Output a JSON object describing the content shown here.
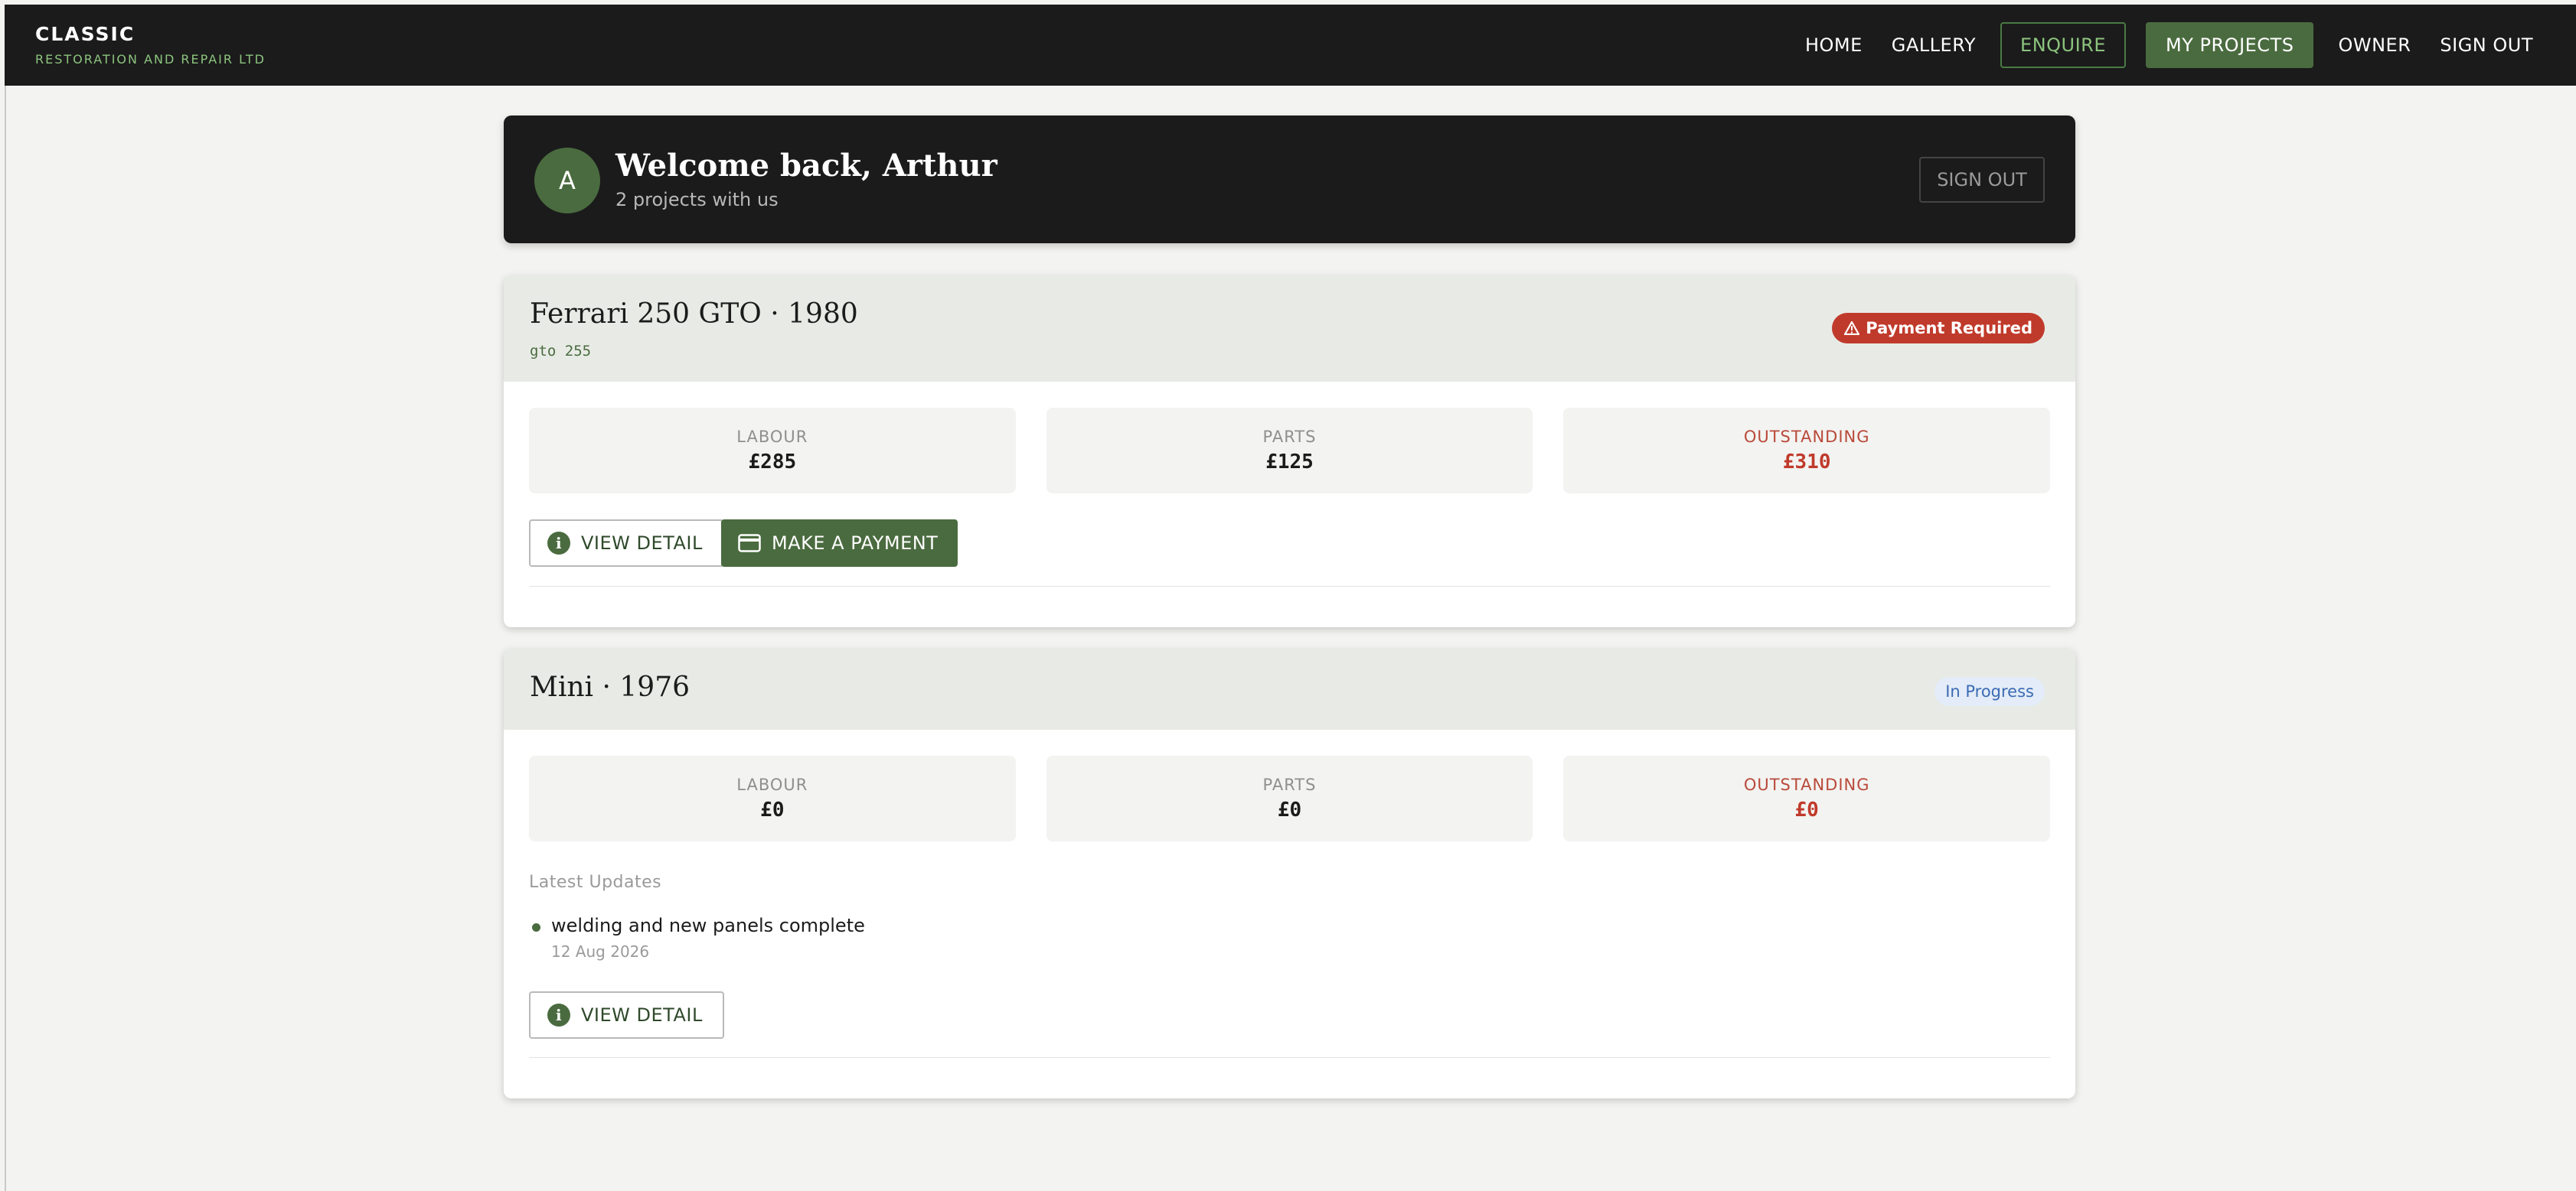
{
  "brand": {
    "name": "CLASSIC",
    "subtitle": "RESTORATION AND REPAIR LTD"
  },
  "nav": {
    "home": "HOME",
    "gallery": "GALLERY",
    "enquire": "ENQUIRE",
    "my_projects": "MY PROJECTS",
    "owner": "OWNER",
    "sign_out": "SIGN OUT"
  },
  "welcome": {
    "avatar_initial": "A",
    "title": "Welcome back, Arthur",
    "subtitle": "2 projects with us",
    "sign_out": "SIGN OUT"
  },
  "projects": [
    {
      "title": "Ferrari 250 GTO · 1980",
      "registration": "gto 255",
      "status": "Payment Required",
      "status_icon": "warning-icon",
      "stats": [
        {
          "label": "LABOUR",
          "value": "£285"
        },
        {
          "label": "PARTS",
          "value": "£125"
        },
        {
          "label": "OUTSTANDING",
          "value": "£310"
        }
      ],
      "view_detail": "VIEW DETAIL",
      "make_payment": "MAKE A PAYMENT"
    },
    {
      "title": "Mini · 1976",
      "status": "In Progress",
      "stats": [
        {
          "label": "LABOUR",
          "value": "£0"
        },
        {
          "label": "PARTS",
          "value": "£0"
        },
        {
          "label": "OUTSTANDING",
          "value": "£0"
        }
      ],
      "updates_title": "Latest Updates",
      "updates": [
        {
          "text": "welding and new panels complete",
          "date": "12 Aug 2026"
        }
      ],
      "view_detail": "VIEW DETAIL"
    }
  ],
  "colors": {
    "nav_bg": "#1b1b1b",
    "accent_green": "#4a6b3f",
    "brand_green": "#8cc47e",
    "alert_red": "#c03a2b",
    "progress_blue": "#3b6bb3"
  }
}
